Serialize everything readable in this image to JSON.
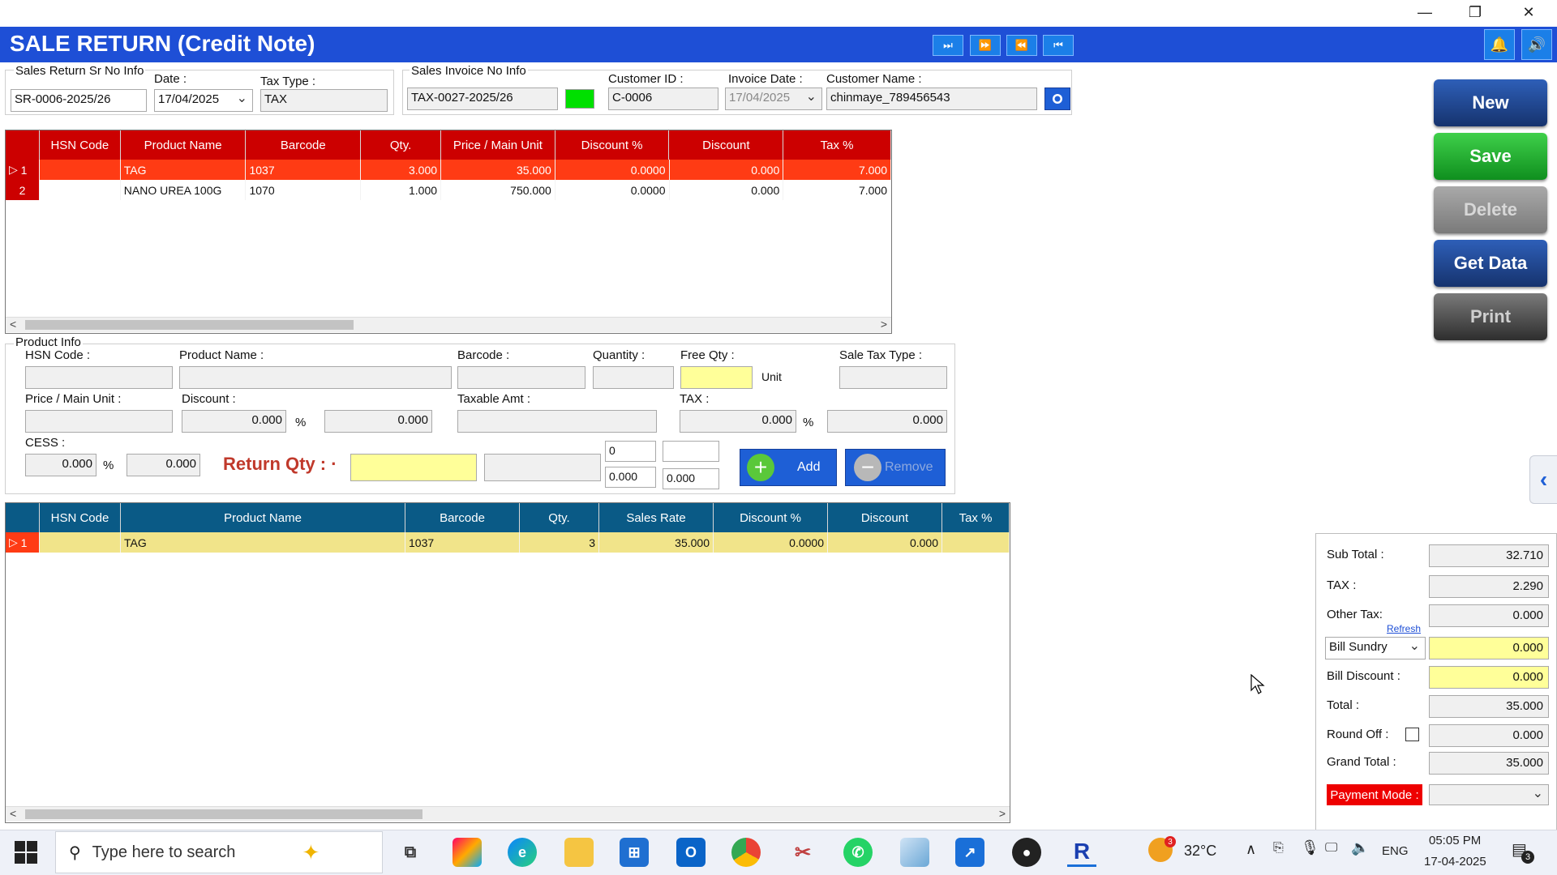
{
  "window": {
    "minimize": "—",
    "restore": "❐",
    "close": "✕"
  },
  "header": {
    "title": "SALE RETURN (Credit Note)",
    "bg": "#1e4fd6"
  },
  "nav": {
    "last": "⏭",
    "next": "⏩",
    "prev": "⏪",
    "first": "⏮"
  },
  "header_icons": {
    "bell": "🔔",
    "speaker": "🔊"
  },
  "return_info": {
    "group_label": "Sales Return Sr No Info",
    "sr_no": "SR-0006-2025/26",
    "date_label": "Date :",
    "date": "17/04/2025",
    "tax_type_label": "Tax Type :",
    "tax_type": "TAX"
  },
  "invoice_info": {
    "group_label": "Sales Invoice No Info",
    "invoice_no": "TAX-0027-2025/26",
    "status_color": "#00e000",
    "customer_id_label": "Customer ID :",
    "customer_id": "C-0006",
    "invoice_date_label": "Invoice Date :",
    "invoice_date": "17/04/2025",
    "customer_name_label": "Customer Name :",
    "customer_name": "chinmaye_789456543"
  },
  "invoice_grid": {
    "header_color": "#cc0000",
    "columns": [
      "HSN Code",
      "Product Name",
      "Barcode",
      "Qty.",
      "Price / Main Unit",
      "Discount %",
      "Discount",
      "Tax %"
    ],
    "rows": [
      {
        "idx": "1",
        "hsn": "",
        "name": "TAG",
        "barcode": "1037",
        "qty": "3.000",
        "price": "35.000",
        "disc_pct": "0.0000",
        "disc": "0.000",
        "tax": "7.000"
      },
      {
        "idx": "2",
        "hsn": "",
        "name": "NANO UREA 100G",
        "barcode": "1070",
        "qty": "1.000",
        "price": "750.000",
        "disc_pct": "0.0000",
        "disc": "0.000",
        "tax": "7.000"
      }
    ]
  },
  "product_info": {
    "group_label": "Product Info",
    "hsn_label": "HSN Code :",
    "name_label": "Product Name :",
    "barcode_label": "Barcode :",
    "quantity_label": "Quantity :",
    "free_qty_label": "Free Qty :",
    "unit_label": "Unit",
    "sale_tax_type_label": "Sale Tax Type :",
    "price_label": "Price / Main Unit :",
    "discount_label": "Discount :",
    "discount_pct": "0.000",
    "discount_amt": "0.000",
    "pct_symbol": "%",
    "taxable_label": "Taxable Amt :",
    "tax_label": "TAX :",
    "tax_pct": "0.000",
    "tax_amt": "0.000",
    "cess_label": "CESS :",
    "cess_pct": "0.000",
    "cess_amt": "0.000",
    "return_qty_label": "Return Qty : ·",
    "small_top": "0",
    "small_bottom": "0.000",
    "small_bottom2": "0.000",
    "add_label": "Add",
    "remove_label": "Remove"
  },
  "return_grid": {
    "header_color": "#0a5a86",
    "columns": [
      "HSN Code",
      "Product Name",
      "Barcode",
      "Qty.",
      "Sales Rate",
      "Discount %",
      "Discount",
      "Tax %"
    ],
    "rows": [
      {
        "idx": "1",
        "hsn": "",
        "name": "TAG",
        "barcode": "1037",
        "qty": "3",
        "rate": "35.000",
        "disc_pct": "0.0000",
        "disc": "0.000",
        "tax": ""
      }
    ]
  },
  "actions": {
    "new": "New",
    "save": "Save",
    "delete": "Delete",
    "get_data": "Get Data",
    "print": "Print"
  },
  "totals": {
    "sub_total_label": "Sub Total :",
    "sub_total": "32.710",
    "tax_label": "TAX :",
    "tax": "2.290",
    "other_tax_label": "Other Tax:",
    "other_tax": "0.000",
    "refresh_label": "Refresh",
    "bill_sundry_label": "Bill Sundry",
    "bill_sundry": "0.000",
    "bill_discount_label": "Bill Discount :",
    "bill_discount": "0.000",
    "total_label": "Total :",
    "total": "35.000",
    "round_off_label": "Round Off :",
    "round_off": "0.000",
    "grand_total_label": "Grand Total :",
    "grand_total": "35.000",
    "payment_mode_label": "Payment Mode :",
    "payment_mode": ""
  },
  "taskbar": {
    "search_placeholder": "Type here to search",
    "weather": "32°C",
    "weather_badge": "3",
    "language": "ENG",
    "time": "05:05 PM",
    "date": "17-04-2025",
    "notif_count": "3"
  }
}
